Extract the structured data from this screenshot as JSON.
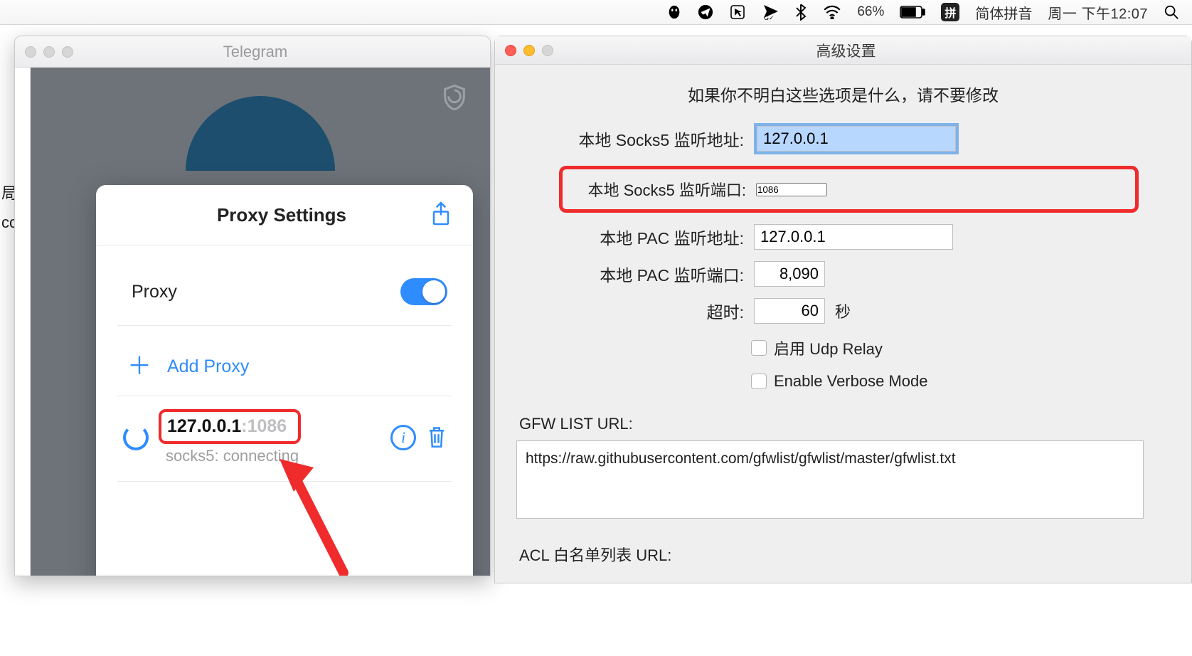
{
  "menubar": {
    "battery_pct": "66%",
    "ime_box": "拼",
    "ime_label": "简体拼音",
    "clock": "周一 下午12:07"
  },
  "telegram": {
    "title": "Telegram",
    "popup_title": "Proxy Settings",
    "proxy_label": "Proxy",
    "add_proxy": "Add Proxy",
    "entry_ip": "127.0.0.1",
    "entry_port_sep": ":",
    "entry_port": "1086",
    "entry_status": "socks5: connecting"
  },
  "bgstrip": {
    "a": "局",
    "b": "co"
  },
  "adv": {
    "title": "高级设置",
    "warning": "如果你不明白这些选项是什么，请不要修改",
    "socks_addr_label": "本地 Socks5 监听地址:",
    "socks_addr_value": "127.0.0.1",
    "socks_port_label": "本地 Socks5 监听端口:",
    "socks_port_value": "1086",
    "pac_addr_label": "本地 PAC 监听地址:",
    "pac_addr_value": "127.0.0.1",
    "pac_port_label": "本地 PAC 监听端口:",
    "pac_port_value": "8,090",
    "timeout_label": "超时:",
    "timeout_value": "60",
    "timeout_suffix": "秒",
    "udp_label": "启用 Udp Relay",
    "verbose_label": "Enable Verbose Mode",
    "gfw_label": "GFW LIST URL:",
    "gfw_value": "https://raw.githubusercontent.com/gfwlist/gfwlist/master/gfwlist.txt",
    "acl_label": "ACL 白名单列表 URL:"
  }
}
